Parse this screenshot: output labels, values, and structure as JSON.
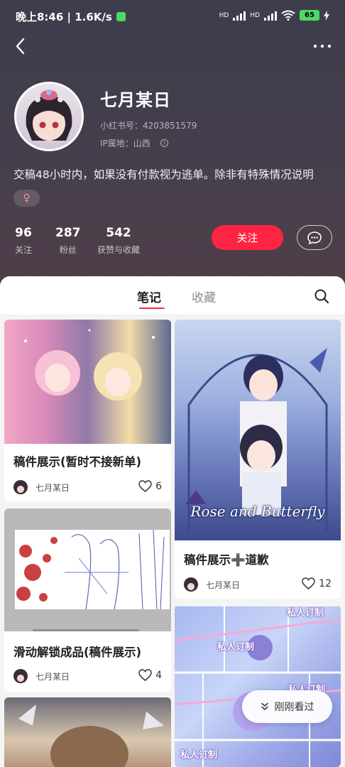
{
  "status_bar": {
    "time_speed": "晚上8:46 | 1.6K/s",
    "signal1": "HD",
    "signal2": "HD",
    "battery": "65"
  },
  "profile": {
    "nickname": "七月某日",
    "xhs_id": "小红书号：4203851579",
    "ip_location": "IP属地：山西",
    "bio": "交稿48小时内，如果没有付款视为逃单。除非有特殊情况说明",
    "gender_symbol": "♀",
    "stats": [
      {
        "num": "96",
        "label": "关注"
      },
      {
        "num": "287",
        "label": "粉丝"
      },
      {
        "num": "542",
        "label": "获赞与收藏"
      }
    ],
    "follow_label": "关注"
  },
  "tabs": {
    "notes": "笔记",
    "collections": "收藏"
  },
  "notes": [
    {
      "title": "稿件展示(暂时不接新单)",
      "author": "七月某日",
      "likes": "6"
    },
    {
      "title": "稿件展示➕道歉",
      "author": "七月某日",
      "likes": "12"
    },
    {
      "title": "滑动解锁成品(稿件展示)",
      "author": "七月某日",
      "likes": "4"
    }
  ],
  "image_text": {
    "rose_butterfly": "Rose and Butterfly",
    "private_custom": "私人订制"
  },
  "fab_label": "刚刚看过",
  "colors": {
    "accent": "#ff2442",
    "header_bg": "#443f4d"
  }
}
